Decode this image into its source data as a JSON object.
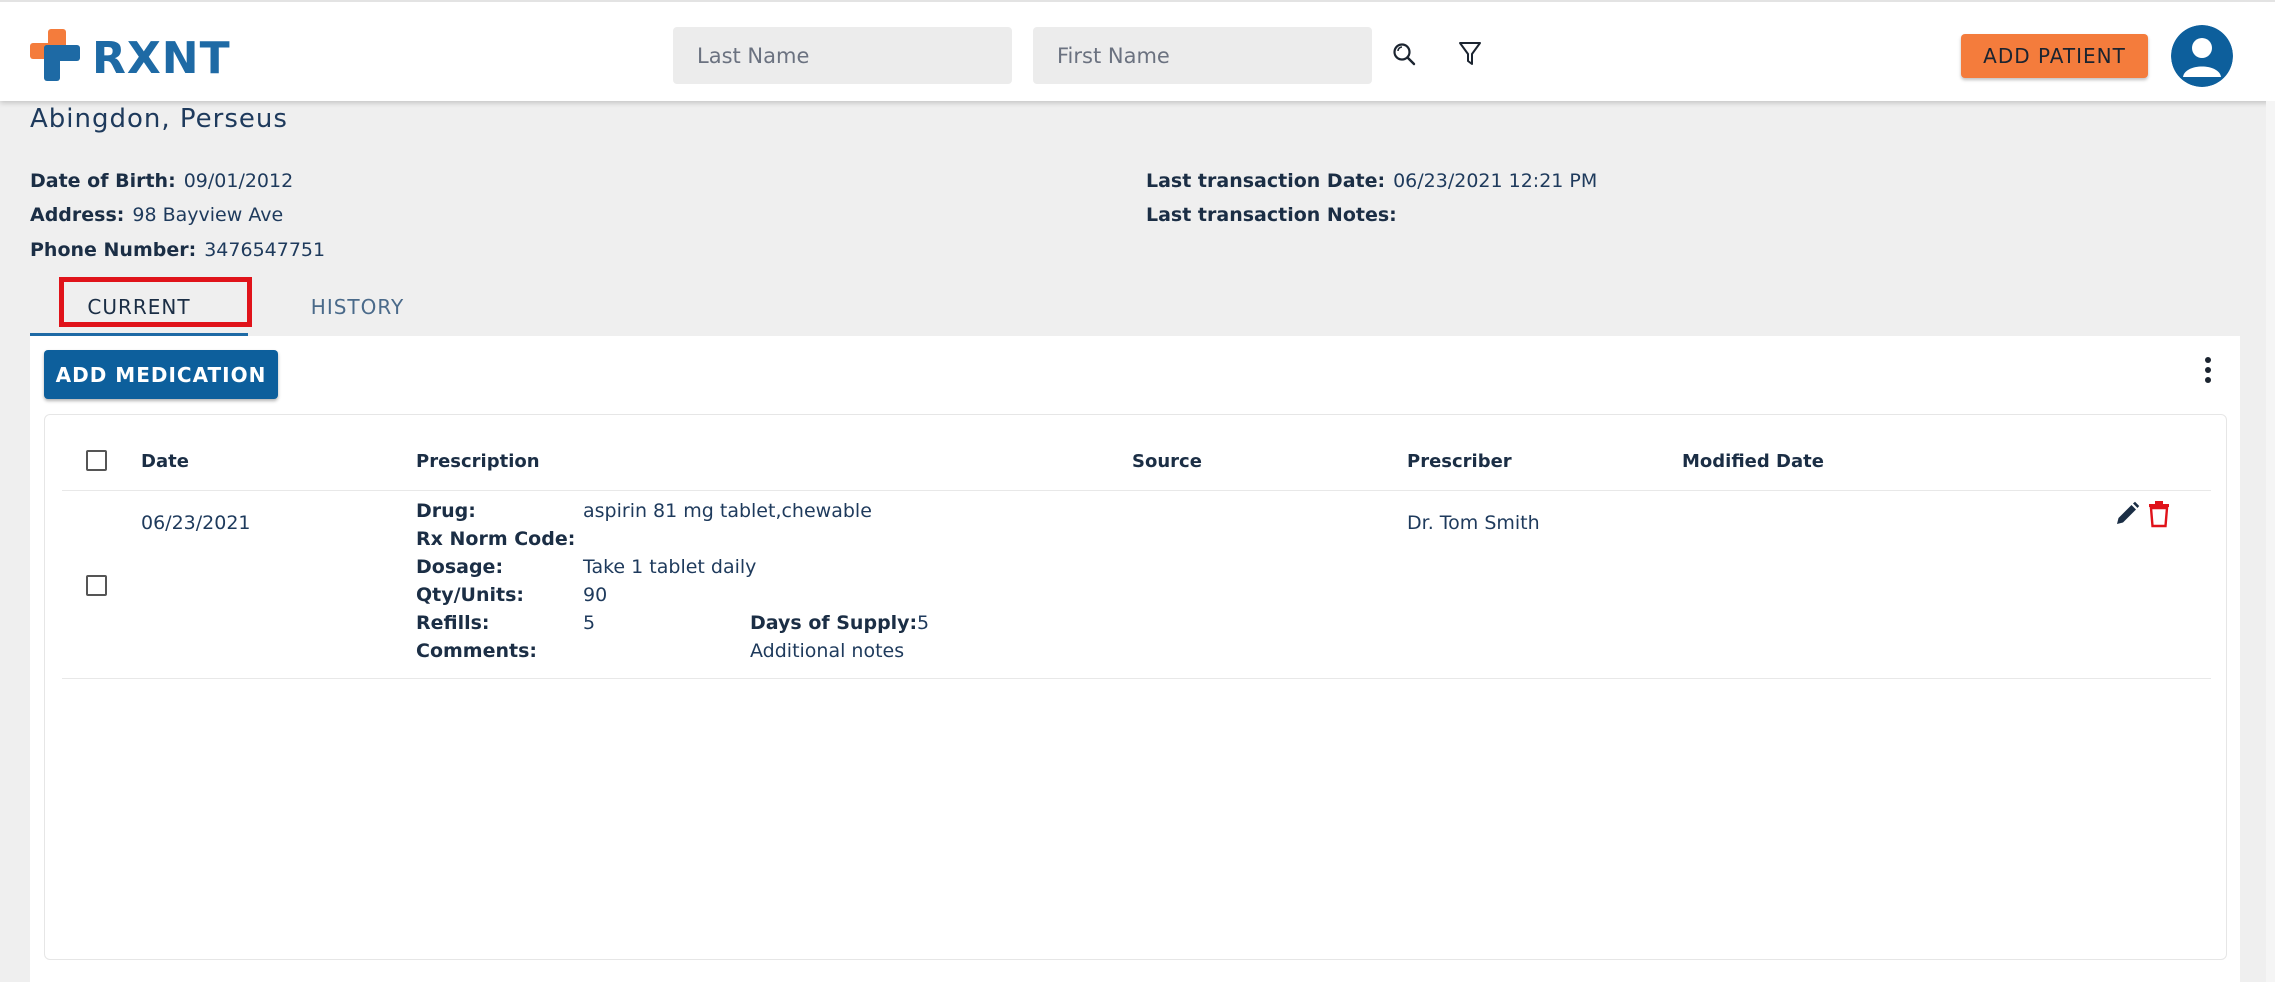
{
  "brand": {
    "name": "RXNT"
  },
  "header": {
    "last_name_placeholder": "Last Name",
    "first_name_placeholder": "First Name",
    "search_icon": "search-icon",
    "filter_icon": "filter-icon",
    "add_patient_label": "ADD PATIENT",
    "avatar_icon": "user-avatar-icon"
  },
  "patient": {
    "name": "Abingdon, Perseus",
    "dob_label": "Date of Birth:",
    "dob": "09/01/2012",
    "address_label": "Address:",
    "address": "98 Bayview Ave",
    "phone_label": "Phone Number:",
    "phone": "3476547751",
    "last_tx_date_label": "Last transaction Date:",
    "last_tx_date": "06/23/2021 12:21 PM",
    "last_tx_notes_label": "Last transaction Notes:",
    "last_tx_notes": ""
  },
  "tabs": [
    {
      "label": "CURRENT",
      "active": true
    },
    {
      "label": "HISTORY",
      "active": false
    }
  ],
  "medications": {
    "add_label": "ADD MEDICATION",
    "columns": [
      "Date",
      "Prescription",
      "Source",
      "Prescriber",
      "Modified Date"
    ],
    "rows": [
      {
        "date": "06/23/2021",
        "drug_label": "Drug:",
        "drug": "aspirin 81 mg tablet,chewable",
        "rxnorm_label": "Rx Norm Code:",
        "rxnorm": "",
        "dosage_label": "Dosage:",
        "dosage": "Take 1 tablet daily",
        "qty_label": "Qty/Units:",
        "qty": "90",
        "refills_label": "Refills:",
        "refills": "5",
        "days_label": "Days of Supply:",
        "days": "5",
        "comments_label": "Comments:",
        "comments": "Additional notes",
        "source": "",
        "prescriber": "Dr. Tom Smith",
        "modified_date": ""
      }
    ]
  },
  "colors": {
    "brand_blue": "#1e6aa5",
    "brand_orange": "#f47c3c",
    "primary_button": "#0d5f9c",
    "delete_red": "#e0131a",
    "highlight_red": "#e0131a"
  }
}
